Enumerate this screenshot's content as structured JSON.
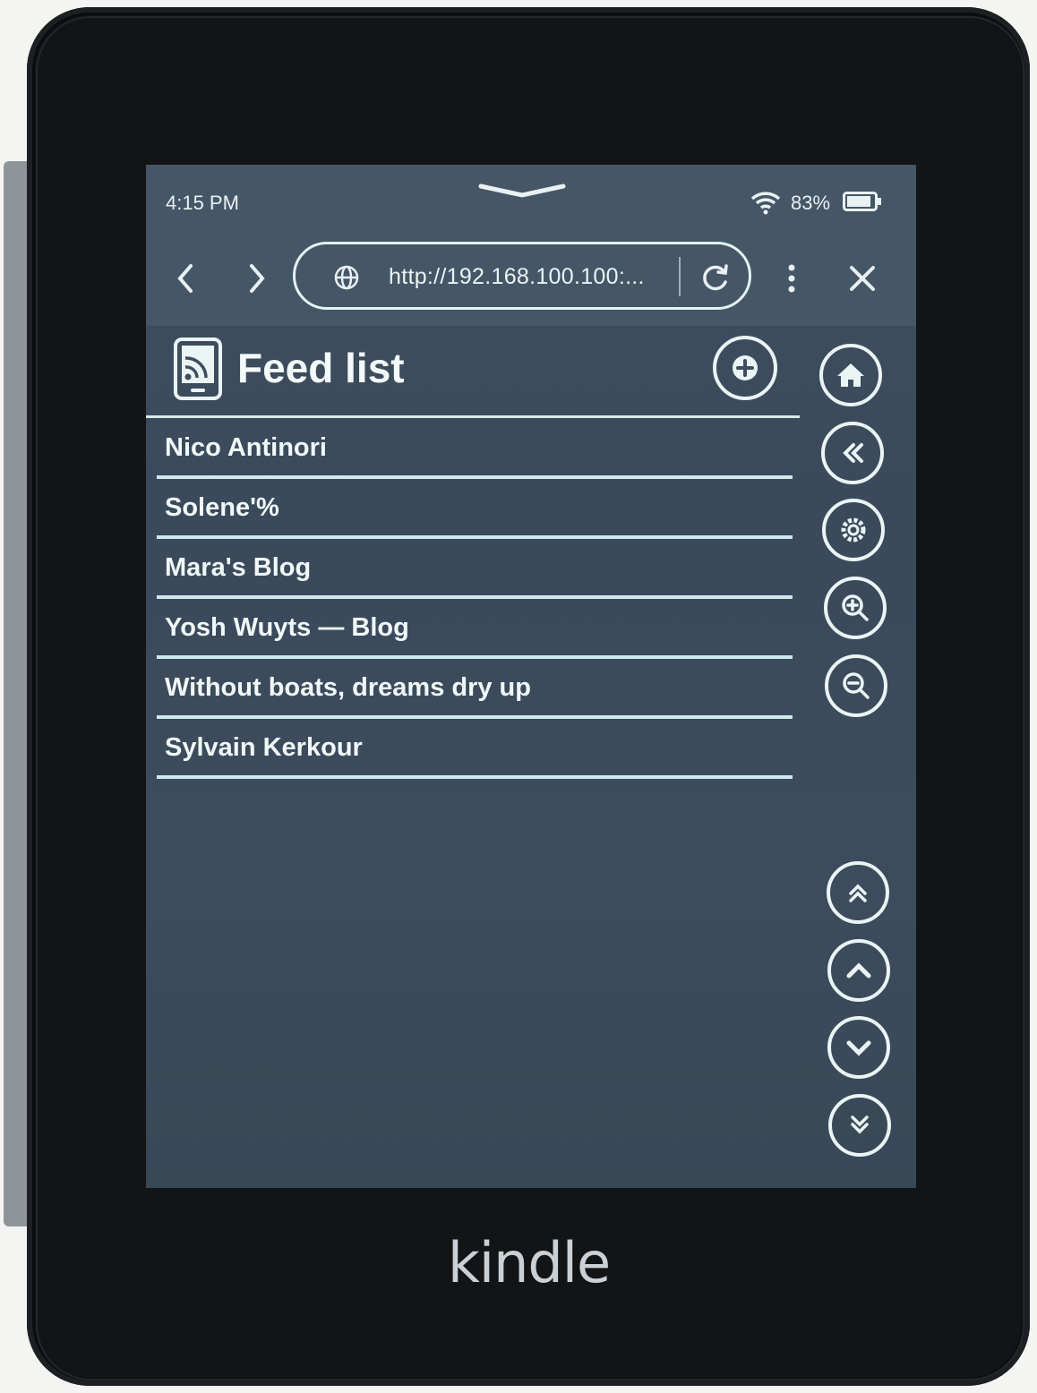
{
  "status": {
    "time": "4:15 PM",
    "battery_percent": "83%"
  },
  "browser": {
    "url": "http://192.168.100.100:..."
  },
  "page": {
    "title": "Feed list"
  },
  "feeds": [
    "Nico Antinori",
    "Solene'%",
    "Mara's Blog",
    "Yosh Wuyts — Blog",
    "Without boats, dreams dry up",
    "Sylvain Kerkour"
  ],
  "device": {
    "brand": "kindle"
  },
  "colors": {
    "screen": "#3c4c5d",
    "ink": "#eaf4f4",
    "bezel": "#121416"
  }
}
